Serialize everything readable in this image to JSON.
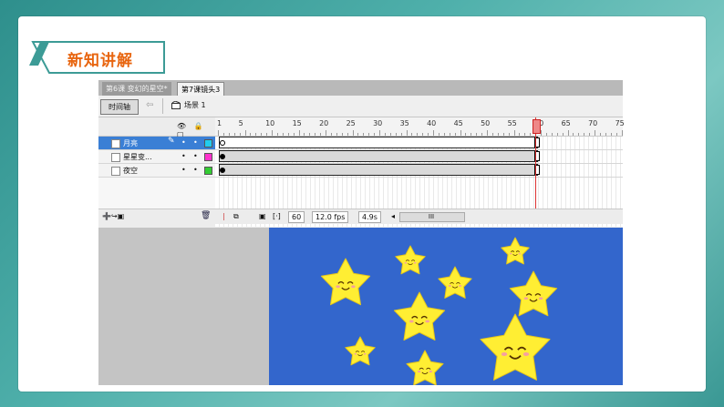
{
  "section_tag": {
    "label": "新知讲解"
  },
  "doc_tabs": [
    {
      "label": "第6课 变幻的星空*"
    },
    {
      "label": "第7课镜头3"
    }
  ],
  "toolbar": {
    "timeline_button": "时间轴",
    "scene_label": "场景 1"
  },
  "layers_header_icons": "👁 🔒 ▢",
  "ruler_labels": [
    "1",
    "5",
    "10",
    "15",
    "20",
    "25",
    "30",
    "35",
    "40",
    "45",
    "50",
    "55",
    "60",
    "65",
    "70",
    "75"
  ],
  "layers": [
    {
      "name": "月亮",
      "color": "#22ccee",
      "selected": true
    },
    {
      "name": "星星变...",
      "color": "#ff33cc",
      "selected": false
    },
    {
      "name": "夜空",
      "color": "#33cc33",
      "selected": false
    }
  ],
  "status": {
    "frame": "60",
    "fps": "12.0 fps",
    "time": "4.9s",
    "scroll_thumb": "III"
  },
  "colors": {
    "stage": "#3366cc",
    "star": "#ffee33",
    "accent": "#e8650f"
  }
}
